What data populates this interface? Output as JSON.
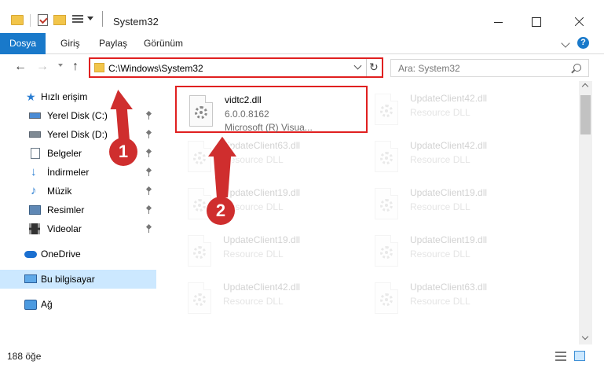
{
  "window": {
    "title": "System32"
  },
  "ribbon": {
    "tabs": [
      "Dosya",
      "Giriş",
      "Paylaş",
      "Görünüm"
    ]
  },
  "address": {
    "path": "C:\\Windows\\System32",
    "search_placeholder": "Ara: System32"
  },
  "sidebar": {
    "quick_access": "Hızlı erişim",
    "items": [
      {
        "label": "Yerel Disk (C:)",
        "icon": "drive-icon",
        "pinned": true
      },
      {
        "label": "Yerel Disk (D:)",
        "icon": "drive-icon",
        "pinned": true
      },
      {
        "label": "Belgeler",
        "icon": "documents-icon",
        "pinned": true
      },
      {
        "label": "İndirmeler",
        "icon": "downloads-icon",
        "pinned": true
      },
      {
        "label": "Müzik",
        "icon": "music-icon",
        "pinned": true
      },
      {
        "label": "Resimler",
        "icon": "pictures-icon",
        "pinned": true
      },
      {
        "label": "Videolar",
        "icon": "videos-icon",
        "pinned": true
      }
    ],
    "onedrive": "OneDrive",
    "this_pc": "Bu bilgisayar",
    "network": "Ağ"
  },
  "files": [
    {
      "name": "vidtc2.dll",
      "line2": "6.0.0.8162",
      "line3": "Microsoft (R) Visua...",
      "highlight": true
    },
    {
      "name": "UpdateClient42.dll",
      "line2": "Resource DLL"
    },
    {
      "name": "UpdateClient63.dll",
      "line2": "Resource DLL"
    },
    {
      "name": "UpdateClient42.dll",
      "line2": "Resource DLL"
    },
    {
      "name": "UpdateClient19.dll",
      "line2": "Resource DLL"
    },
    {
      "name": "UpdateClient19.dll",
      "line2": "Resource DLL"
    },
    {
      "name": "UpdateClient19.dll",
      "line2": "Resource DLL"
    },
    {
      "name": "UpdateClient19.dll",
      "line2": "Resource DLL"
    },
    {
      "name": "UpdateClient42.dll",
      "line2": "Resource DLL"
    },
    {
      "name": "UpdateClient63.dll",
      "line2": "Resource DLL"
    }
  ],
  "status": {
    "count": "188 öğe"
  },
  "annotations": {
    "step1": "1",
    "step2": "2",
    "color": "#cf2e2e"
  },
  "colors": {
    "accent": "#1979ca",
    "highlight_border": "#e02020",
    "selected_bg": "#cce8ff"
  }
}
